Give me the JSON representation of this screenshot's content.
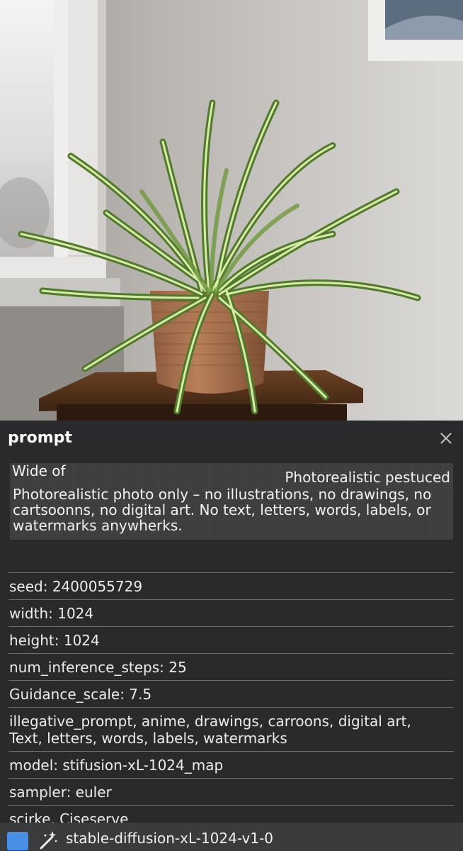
{
  "panel": {
    "title": "prompt",
    "close_icon": "close-icon"
  },
  "prompt_box": {
    "line1_left": "Wide of",
    "line1_right": "Photorealistic pestuced",
    "body": "Photorealistic photo only – no illustrations, no drawings, no cartsoonns, no digital art. No text, letters, words, labels, or watermarks anywherks."
  },
  "params": [
    "seed: 2400055729",
    "width: 1024",
    "height: 1024",
    "num_inference_steps: 25",
    "Guidance_scale: 7.5",
    "illegative_prompt, anime, drawings, carroons, digital art,\n Text, letters, words, labels, watermarks",
    "model: stifusion-xL-1024_map",
    "sampler: euler",
    "scirke. Ciseserve"
  ],
  "bottom_bar": {
    "model_name": "stable-diffusion-xL-1024-v1-0",
    "square_icon_color": "#4a8fe6",
    "icons": [
      "square-icon",
      "magic-wand-icon"
    ]
  }
}
